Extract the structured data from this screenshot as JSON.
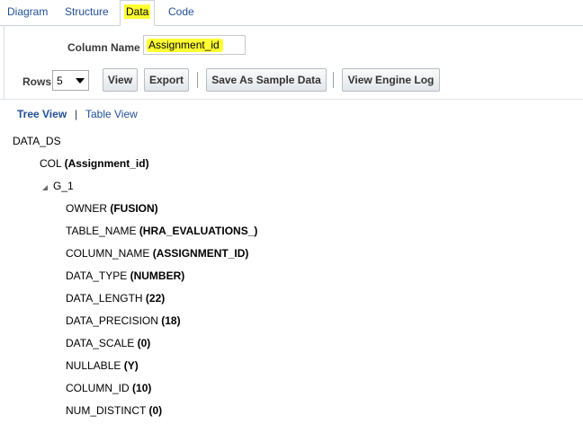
{
  "tabs": [
    {
      "label": "Diagram"
    },
    {
      "label": "Structure"
    },
    {
      "label": "Data"
    },
    {
      "label": "Code"
    }
  ],
  "active_tab": "Data",
  "column_name": {
    "label": "Column Name",
    "value": "Assignment_id"
  },
  "toolbar": {
    "rows_label": "Rows",
    "rows_value": "5",
    "view_label": "View",
    "export_label": "Export",
    "save_sample_label": "Save As Sample Data",
    "engine_log_label": "View Engine Log"
  },
  "view_toggle": {
    "tree_view": "Tree View",
    "separator": "|",
    "table_view": "Table View"
  },
  "tree": {
    "root": "DATA_DS",
    "col": {
      "name": "COL",
      "value": "(Assignment_id)"
    },
    "group": "G_1",
    "fields": [
      {
        "name": "OWNER",
        "value": "(FUSION)"
      },
      {
        "name": "TABLE_NAME",
        "value": "(HRA_EVALUATIONS_)"
      },
      {
        "name": "COLUMN_NAME",
        "value": "(ASSIGNMENT_ID)"
      },
      {
        "name": "DATA_TYPE",
        "value": "(NUMBER)"
      },
      {
        "name": "DATA_LENGTH",
        "value": "(22)"
      },
      {
        "name": "DATA_PRECISION",
        "value": "(18)"
      },
      {
        "name": "DATA_SCALE",
        "value": "(0)"
      },
      {
        "name": "NULLABLE",
        "value": "(Y)"
      },
      {
        "name": "COLUMN_ID",
        "value": "(10)"
      },
      {
        "name": "NUM_DISTINCT",
        "value": "(0)"
      }
    ]
  },
  "colors": {
    "link": "#1f4e96",
    "highlight": "#ffff33"
  }
}
